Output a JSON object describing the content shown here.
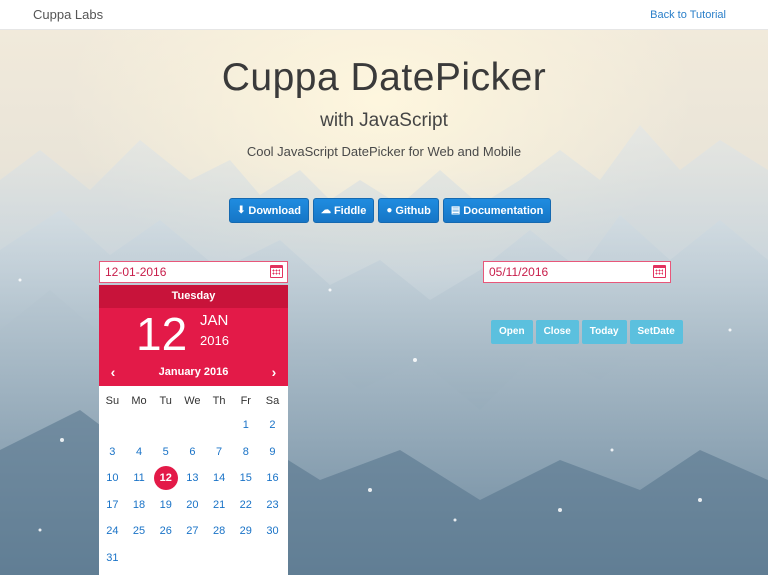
{
  "navbar": {
    "brand": "Cuppa Labs",
    "back_link": "Back to Tutorial"
  },
  "hero": {
    "title": "Cuppa DatePicker",
    "subtitle": "with JavaScript",
    "tagline": "Cool JavaScript DatePicker for Web and Mobile"
  },
  "buttons": [
    {
      "label": "Download",
      "icon": "download-icon"
    },
    {
      "label": "Fiddle",
      "icon": "cloud-icon"
    },
    {
      "label": "Github",
      "icon": "github-icon"
    },
    {
      "label": "Documentation",
      "icon": "book-icon"
    }
  ],
  "picker1": {
    "value": "12-01-2016",
    "icon": "calendar-icon"
  },
  "picker2": {
    "value": "05/11/2016",
    "icon": "calendar-icon"
  },
  "calendar": {
    "day_name": "Tuesday",
    "day": "12",
    "month": "JAN",
    "year": "2016",
    "month_year": "January 2016",
    "weekdays": [
      "Su",
      "Mo",
      "Tu",
      "We",
      "Th",
      "Fr",
      "Sa"
    ],
    "leading_blanks": 5,
    "days": [
      "1",
      "2",
      "3",
      "4",
      "5",
      "6",
      "7",
      "8",
      "9",
      "10",
      "11",
      "12",
      "13",
      "14",
      "15",
      "16",
      "17",
      "18",
      "19",
      "20",
      "21",
      "22",
      "23",
      "24",
      "25",
      "26",
      "27",
      "28",
      "29",
      "30",
      "31"
    ],
    "selected": "12",
    "colors": {
      "header_dark": "#c8133a",
      "header": "#e31a48",
      "day_link": "#1a73c7"
    }
  },
  "actions": [
    "Open",
    "Close",
    "Today",
    "SetDate"
  ],
  "colors": {
    "primary_button": "#1a80d4",
    "info_button": "#5bc0de",
    "accent": "#e31a48"
  }
}
